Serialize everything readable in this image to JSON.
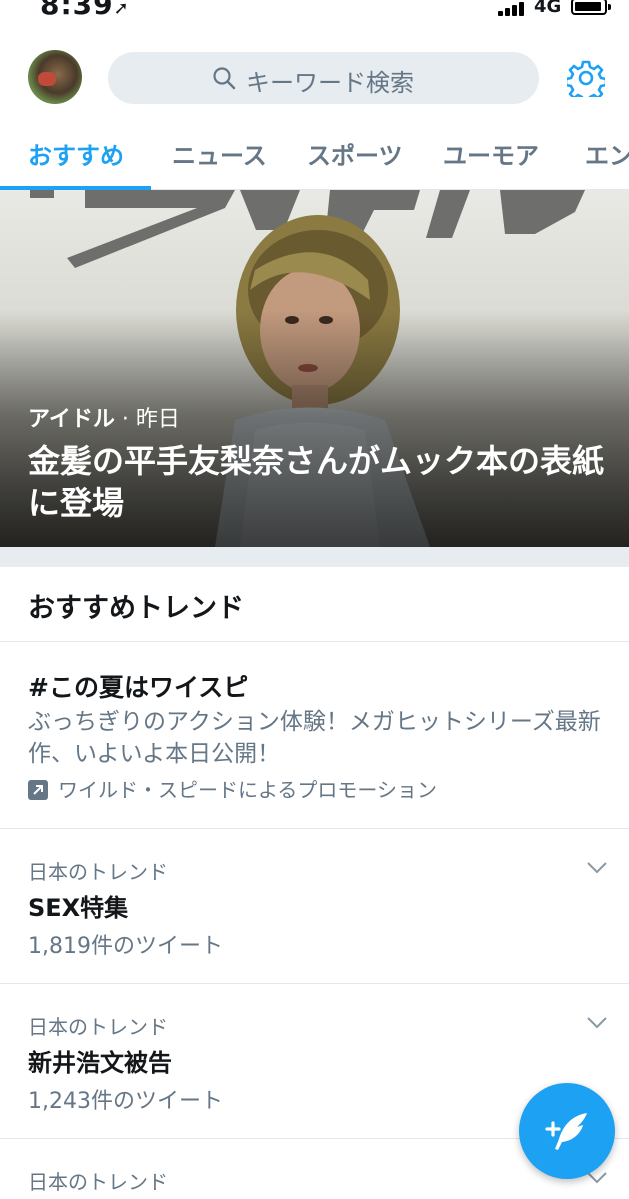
{
  "status_bar": {
    "time": "8:39",
    "network": "4G"
  },
  "header": {
    "search_placeholder": "キーワード検索"
  },
  "tabs": [
    {
      "label": "おすすめ",
      "active": true
    },
    {
      "label": "ニュース",
      "active": false
    },
    {
      "label": "スポーツ",
      "active": false
    },
    {
      "label": "ユーモア",
      "active": false
    },
    {
      "label": "エン",
      "active": false
    }
  ],
  "hero": {
    "category": "アイドル",
    "separator": "·",
    "time": "昨日",
    "title": "金髪の平手友梨奈さんがムック本の表紙に登場"
  },
  "trends": {
    "section_title": "おすすめトレンド",
    "promoted": {
      "tag": "#この夏はワイスピ",
      "description": "ぶっちぎりのアクション体験！メガヒットシリーズ最新作、いよいよ本日公開！",
      "promoted_by": "ワイルド・スピードによるプロモーション"
    },
    "items": [
      {
        "context": "日本のトレンド",
        "name": "SEX特集",
        "count": "1,819件のツイート"
      },
      {
        "context": "日本のトレンド",
        "name": "新井浩文被告",
        "count": "1,243件のツイート"
      },
      {
        "context": "日本のトレンド"
      }
    ]
  },
  "colors": {
    "accent": "#1da1f2",
    "muted": "#657786",
    "divider": "#e1e8ed",
    "search_bg": "#e6ecf0"
  },
  "icons": {
    "search": "search-icon",
    "settings": "gear-icon",
    "promoted": "promoted-icon",
    "more": "chevron-down-icon",
    "compose": "compose-tweet-icon"
  }
}
